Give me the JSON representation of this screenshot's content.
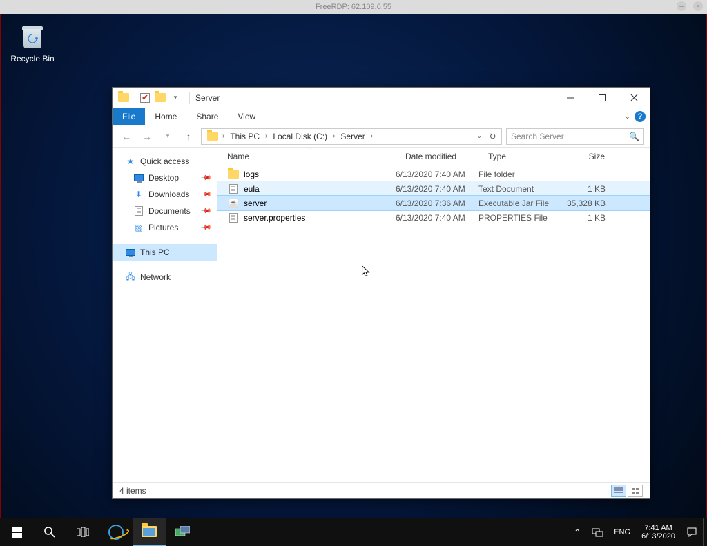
{
  "outer": {
    "title": "FreeRDP: 62.109.6.55"
  },
  "desktop": {
    "recycle_label": "Recycle Bin"
  },
  "explorer": {
    "title": "Server",
    "tabs": {
      "file": "File",
      "home": "Home",
      "share": "Share",
      "view": "View"
    },
    "breadcrumb": [
      "This PC",
      "Local Disk (C:)",
      "Server"
    ],
    "search_placeholder": "Search Server",
    "sidebar": {
      "quick_access": "Quick access",
      "desktop": "Desktop",
      "downloads": "Downloads",
      "documents": "Documents",
      "pictures": "Pictures",
      "this_pc": "This PC",
      "network": "Network"
    },
    "columns": {
      "name": "Name",
      "date": "Date modified",
      "type": "Type",
      "size": "Size"
    },
    "rows": [
      {
        "name": "logs",
        "date": "6/13/2020 7:40 AM",
        "type": "File folder",
        "size": "",
        "icon": "folder"
      },
      {
        "name": "eula",
        "date": "6/13/2020 7:40 AM",
        "type": "Text Document",
        "size": "1 KB",
        "icon": "doc"
      },
      {
        "name": "server",
        "date": "6/13/2020 7:36 AM",
        "type": "Executable Jar File",
        "size": "35,328 KB",
        "icon": "jar"
      },
      {
        "name": "server.properties",
        "date": "6/13/2020 7:40 AM",
        "type": "PROPERTIES File",
        "size": "1 KB",
        "icon": "doc"
      }
    ],
    "status": "4 items"
  },
  "taskbar": {
    "lang": "ENG",
    "time": "7:41 AM",
    "date": "6/13/2020"
  }
}
